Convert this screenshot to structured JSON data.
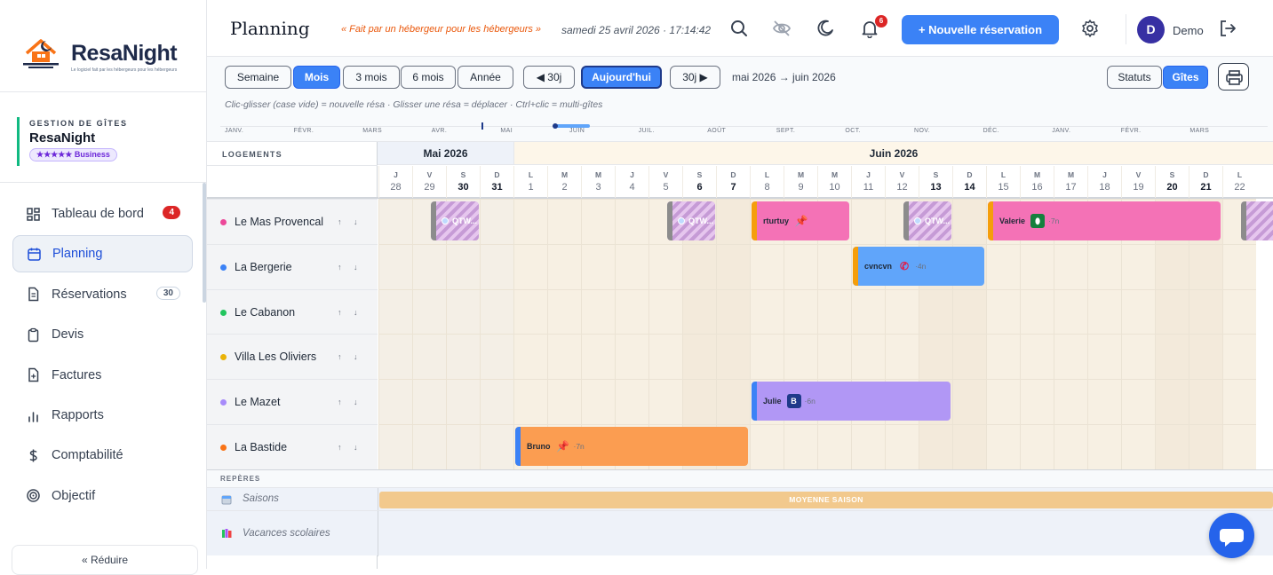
{
  "brand": {
    "name": "ResaNight",
    "tagline": "Le logiciel fait par les hébergeurs pour les hébergeurs"
  },
  "sidebar": {
    "section_caption": "GESTION DE GÎTES",
    "org_name": "ResaNight",
    "plan_badge": "★★★★★ Business",
    "items": [
      {
        "label": "Tableau de bord",
        "icon": "dashboard-icon",
        "count": "4"
      },
      {
        "label": "Planning",
        "icon": "calendar-icon",
        "active": true
      },
      {
        "label": "Réservations",
        "icon": "document-icon",
        "count": "30"
      },
      {
        "label": "Devis",
        "icon": "clipboard-icon"
      },
      {
        "label": "Factures",
        "icon": "invoice-icon"
      },
      {
        "label": "Rapports",
        "icon": "bar-chart-icon"
      },
      {
        "label": "Comptabilité",
        "icon": "dollar-icon"
      },
      {
        "label": "Objectif",
        "icon": "target-icon"
      }
    ],
    "collapse_label": "« Réduire"
  },
  "header": {
    "title": "Planning",
    "quote": "« Fait par un hébergeur pour les hébergeurs »",
    "datetime": "samedi 25 avril 2026 · 17:14:42",
    "notif_count": "6",
    "new_button": "+ Nouvelle réservation",
    "user_initial": "D",
    "user_name": "Demo"
  },
  "toolbar": {
    "views": [
      "Semaine",
      "Mois",
      "3 mois",
      "6 mois",
      "Année"
    ],
    "active_view": "Mois",
    "prev": "◀ 30j",
    "today": "Aujourd'hui",
    "next": "30j ▶",
    "range": "mai 2026 → juin 2026",
    "toggle_left": "Statuts",
    "toggle_right": "Gîtes",
    "hint": "Clic-glisser (case vide) = nouvelle résa · Glisser une résa = déplacer · Ctrl+clic = multi-gîtes"
  },
  "minimap": {
    "months": [
      "JANV.",
      "FÉVR.",
      "MARS",
      "AVR.",
      "MAI",
      "JUIN",
      "JUIL.",
      "AOÛT",
      "SEPT.",
      "OCT.",
      "NOV.",
      "DÉC.",
      "JANV.",
      "FÉVR.",
      "MARS"
    ]
  },
  "grid": {
    "col_header": "LOGEMENTS",
    "months": [
      {
        "label": "Mai 2026"
      },
      {
        "label": "Juin 2026"
      }
    ],
    "days": [
      {
        "wd": "J",
        "d": "28"
      },
      {
        "wd": "V",
        "d": "29"
      },
      {
        "wd": "S",
        "d": "30",
        "we": true
      },
      {
        "wd": "D",
        "d": "31",
        "we": true
      },
      {
        "wd": "L",
        "d": "1"
      },
      {
        "wd": "M",
        "d": "2"
      },
      {
        "wd": "M",
        "d": "3"
      },
      {
        "wd": "J",
        "d": "4"
      },
      {
        "wd": "V",
        "d": "5"
      },
      {
        "wd": "S",
        "d": "6",
        "we": true
      },
      {
        "wd": "D",
        "d": "7",
        "we": true
      },
      {
        "wd": "L",
        "d": "8"
      },
      {
        "wd": "M",
        "d": "9"
      },
      {
        "wd": "M",
        "d": "10"
      },
      {
        "wd": "J",
        "d": "11"
      },
      {
        "wd": "V",
        "d": "12"
      },
      {
        "wd": "S",
        "d": "13",
        "we": true
      },
      {
        "wd": "D",
        "d": "14",
        "we": true
      },
      {
        "wd": "L",
        "d": "15"
      },
      {
        "wd": "M",
        "d": "16"
      },
      {
        "wd": "M",
        "d": "17"
      },
      {
        "wd": "J",
        "d": "18"
      },
      {
        "wd": "V",
        "d": "19"
      },
      {
        "wd": "S",
        "d": "20",
        "we": true
      },
      {
        "wd": "D",
        "d": "21",
        "we": true
      },
      {
        "wd": "L",
        "d": "22"
      }
    ],
    "lodgings": [
      {
        "name": "Le Mas Provencal",
        "color": "#ec4899"
      },
      {
        "name": "La Bergerie",
        "color": "#3b82f6"
      },
      {
        "name": "Le Cabanon",
        "color": "#22c55e"
      },
      {
        "name": "Villa Les Oliviers",
        "color": "#eab308"
      },
      {
        "name": "Le Mazet",
        "color": "#a78bfa"
      },
      {
        "name": "La Bastide",
        "color": "#f97316"
      }
    ],
    "bookings": [
      {
        "row": 0,
        "start": "29",
        "end": "30",
        "label": "QTW...",
        "style": "hatch",
        "icon": "airbnb-icon"
      },
      {
        "row": 0,
        "start": "5",
        "end": "6",
        "label": "QTW...",
        "style": "hatch",
        "icon": "airbnb-icon"
      },
      {
        "row": 0,
        "start": "8",
        "end": "10",
        "label": "rturtuy",
        "color": "#f472b6",
        "bar": "#f59e0b",
        "icon": "pin-icon"
      },
      {
        "row": 0,
        "start": "12",
        "end": "13",
        "label": "QTW...",
        "style": "hatch",
        "icon": "airbnb-icon"
      },
      {
        "row": 0,
        "start": "15",
        "end": "21",
        "label": "Valerie",
        "color": "#f472b6",
        "bar": "#f59e0b",
        "icon": "drop-icon",
        "nights": "·7n"
      },
      {
        "row": 0,
        "start": "22",
        "end": "22",
        "label": "",
        "style": "hatch"
      },
      {
        "row": 1,
        "start": "11",
        "end": "14",
        "label": "cvncvn",
        "color": "#60a5fa",
        "bar": "#f59e0b",
        "icon": "phone-icon",
        "nights": "·4n"
      },
      {
        "row": 4,
        "start": "8",
        "end": "13",
        "label": "Julie",
        "color": "#b197f5",
        "bar": "#3b82f6",
        "icon": "booking-icon",
        "nights": "·6n"
      },
      {
        "row": 5,
        "start": "1",
        "end": "7",
        "label": "Bruno",
        "color": "#fb9d51",
        "bar": "#3b82f6",
        "icon": "pin-icon",
        "nights": "·7n"
      }
    ],
    "markers_header": "REPÈRES",
    "seasons_label": "Saisons",
    "season_band": "MOYENNE SAISON",
    "holidays_label": "Vacances scolaires"
  }
}
